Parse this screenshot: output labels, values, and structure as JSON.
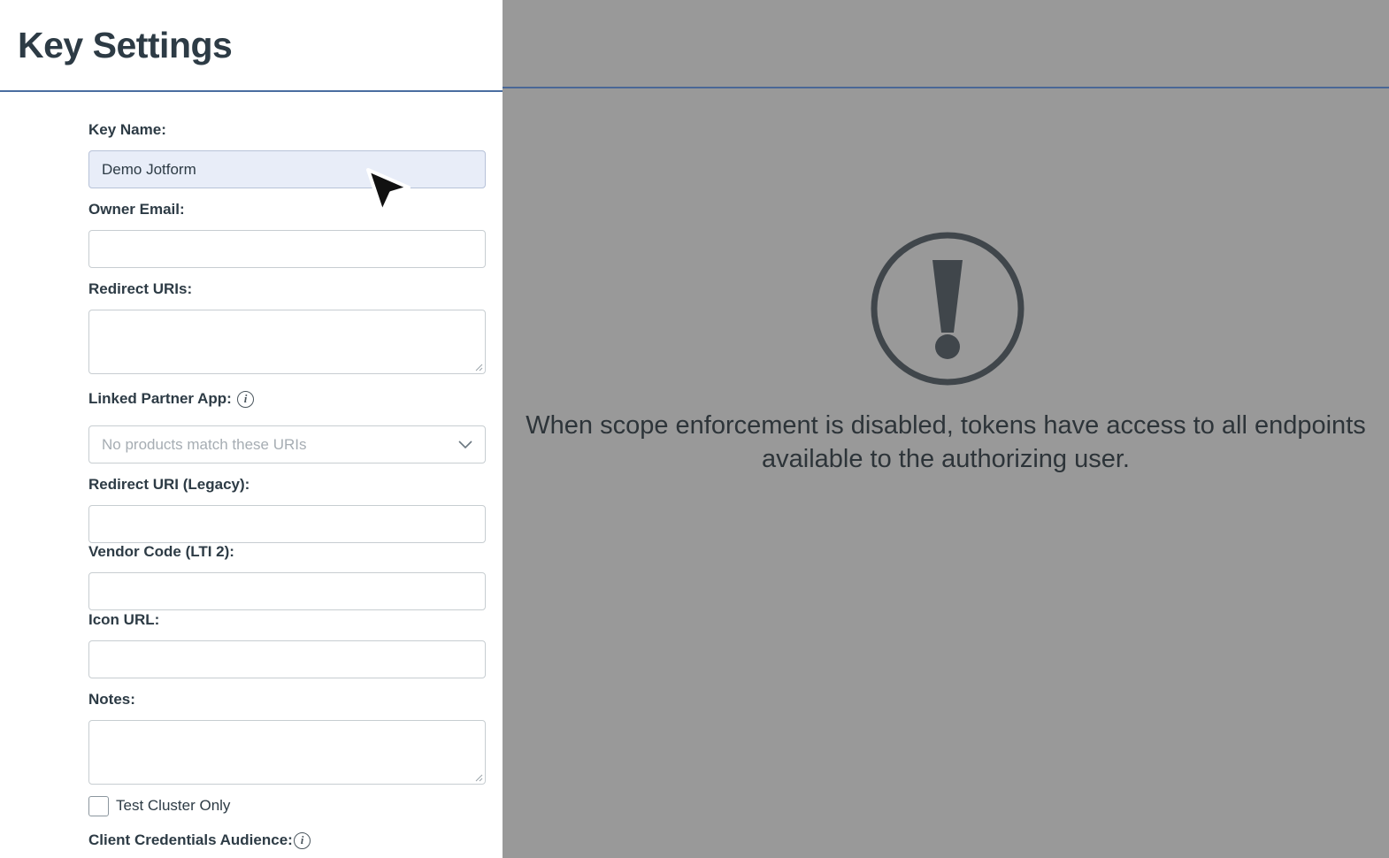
{
  "header": {
    "title": "Key Settings"
  },
  "form": {
    "key_name": {
      "label": "Key Name:",
      "value": "Demo Jotform"
    },
    "owner_email": {
      "label": "Owner Email:",
      "value": ""
    },
    "redirect_uris": {
      "label": "Redirect URIs:",
      "value": ""
    },
    "linked_partner_app": {
      "label": "Linked Partner App:",
      "placeholder": "No products match these URIs"
    },
    "redirect_uri_legacy": {
      "label": "Redirect URI (Legacy):",
      "value": ""
    },
    "vendor_code": {
      "label": "Vendor Code (LTI 2):",
      "value": ""
    },
    "icon_url": {
      "label": "Icon URL:",
      "value": ""
    },
    "notes": {
      "label": "Notes:",
      "value": ""
    },
    "test_cluster_only": {
      "label": "Test Cluster Only",
      "checked": false
    },
    "client_credentials_audience": {
      "label": "Client Credentials Audience:"
    }
  },
  "icons": {
    "info": "i",
    "alert": "exclamation-circle-icon",
    "chevron": "chevron-down-icon",
    "cursor": "mouse-pointer-icon"
  },
  "overlay": {
    "message": "When scope enforcement is disabled, tokens have access to all endpoints available to the authorizing user."
  },
  "colors": {
    "overlay_background": "#999999",
    "accent_line": "#4a6da0",
    "active_input": "#e8edf8",
    "text": "#2d3b45"
  }
}
